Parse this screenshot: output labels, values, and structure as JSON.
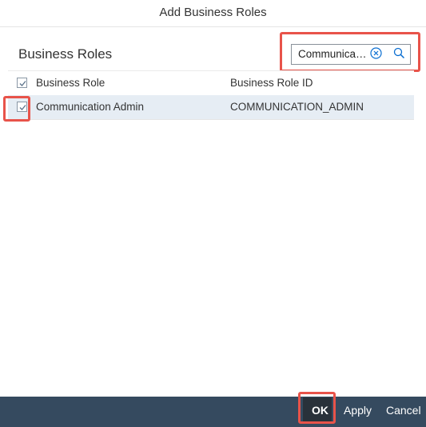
{
  "dialog": {
    "title": "Add Business Roles"
  },
  "section": {
    "title": "Business Roles"
  },
  "search": {
    "value": "Communica…",
    "clear_icon": "clear-icon",
    "search_icon": "search-icon"
  },
  "table": {
    "columns": [
      "Business Role",
      "Business Role ID"
    ],
    "rows": [
      {
        "business_role": "Communication Admin",
        "business_role_id": "COMMUNICATION_ADMIN",
        "selected": true
      }
    ]
  },
  "footer": {
    "ok_label": "OK",
    "apply_label": "Apply",
    "cancel_label": "Cancel"
  },
  "colors": {
    "highlight": "#e8534a",
    "footer_bg": "#354a5f",
    "selected_row": "#e6edf4"
  }
}
